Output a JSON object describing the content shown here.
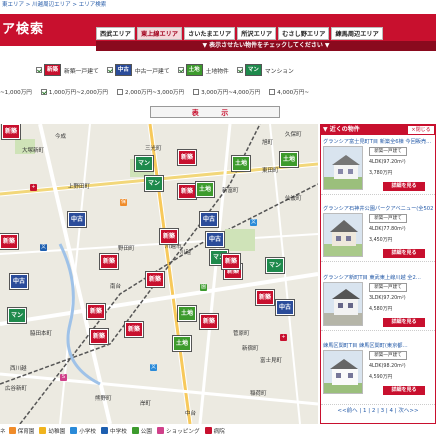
{
  "breadcrumb": [
    "東エリア",
    "川越周辺エリア",
    "エリア検索"
  ],
  "page_title": "ア検索",
  "area_tabs": [
    {
      "label": "西武エリア",
      "active": false
    },
    {
      "label": "東上線エリア",
      "active": true
    },
    {
      "label": "さいたまエリア",
      "active": false
    },
    {
      "label": "所沢エリア",
      "active": false
    },
    {
      "label": "むさし野エリア",
      "active": false
    },
    {
      "label": "練馬周辺エリア",
      "active": false
    }
  ],
  "banner_text": "▼ 表示させたい物件をチェックしてください ▼",
  "property_types": [
    {
      "badge": "新築",
      "label": "新築一戸建て",
      "checked": true,
      "color": "#c8102e"
    },
    {
      "badge": "中古",
      "label": "中古一戸建て",
      "checked": true,
      "color": "#2b4c9a"
    },
    {
      "badge": "土地",
      "label": "土地物件",
      "checked": true,
      "color": "#3d9b2d"
    },
    {
      "badge": "マン",
      "label": "マンション",
      "checked": true,
      "color": "#1e8a4c"
    }
  ],
  "price_ranges": [
    {
      "label": "~1,000万円",
      "checked": false
    },
    {
      "label": "1,000万円~2,000万円",
      "checked": true
    },
    {
      "label": "2,000万円~3,000万円",
      "checked": false
    },
    {
      "label": "3,000万円~4,000万円",
      "checked": false
    },
    {
      "label": "4,000万円~",
      "checked": false
    }
  ],
  "show_button": "表 示",
  "map": {
    "markers": [
      {
        "kind": "new",
        "text": "新築"
      },
      {
        "kind": "new",
        "text": "新築"
      },
      {
        "kind": "man",
        "text": "マン"
      },
      {
        "kind": "land",
        "text": "土地"
      },
      {
        "kind": "land",
        "text": "土地"
      },
      {
        "kind": "man",
        "text": "マン"
      },
      {
        "kind": "used",
        "text": "中古"
      },
      {
        "kind": "new",
        "text": "新築"
      },
      {
        "kind": "land",
        "text": "土地"
      },
      {
        "kind": "new",
        "text": "新築"
      },
      {
        "kind": "used",
        "text": "中古"
      },
      {
        "kind": "man",
        "text": "マン"
      },
      {
        "kind": "new",
        "text": "新築"
      },
      {
        "kind": "new",
        "text": "新築"
      },
      {
        "kind": "new",
        "text": "新築"
      },
      {
        "kind": "used",
        "text": "中古"
      },
      {
        "kind": "man",
        "text": "マン"
      },
      {
        "kind": "new",
        "text": "新築"
      },
      {
        "kind": "land",
        "text": "土地"
      },
      {
        "kind": "new",
        "text": "新築"
      },
      {
        "kind": "new",
        "text": "新築"
      },
      {
        "kind": "used",
        "text": "中古"
      },
      {
        "kind": "new",
        "text": "新築"
      },
      {
        "kind": "man",
        "text": "マン"
      },
      {
        "kind": "land",
        "text": "土地"
      },
      {
        "kind": "new",
        "text": "新築"
      },
      {
        "kind": "new",
        "text": "新築"
      },
      {
        "kind": "used",
        "text": "中古"
      },
      {
        "kind": "new",
        "text": "新築"
      }
    ],
    "labels": [
      "今成",
      "三光町",
      "大塚新町",
      "上野田町",
      "野田町",
      "川越市",
      "川越",
      "新富町",
      "東田町",
      "仙波町",
      "脇田本町",
      "新宿町",
      "富士見町",
      "菅原町",
      "西川越",
      "久保町",
      "旭町",
      "岸町",
      "稲荷町",
      "南台",
      "熊野町",
      "広谷新町",
      "中台"
    ]
  },
  "side_panel": {
    "heading": "▼ 近くの物件",
    "close_label": "×閉じる",
    "cards": [
      {
        "title": "グランシア富士見町T目 新築全6棟 今回販売…",
        "tag": "新築一戸建て",
        "spec1": "4LDK(97.20m²)",
        "spec2": "3,780万円",
        "button": "詳細を見る"
      },
      {
        "title": "グランシア石神井公園パークアベニュー(全502…",
        "tag": "新築一戸建て",
        "spec1": "4LDK(77.80m²)",
        "spec2": "3,450万円",
        "button": "詳細を見る"
      },
      {
        "title": "グランシア新町T目 東武東上線川越 全2…",
        "tag": "新築一戸建て",
        "spec1": "3LDK(97.20m²)",
        "spec2": "4,580万円",
        "button": "詳細を見る"
      },
      {
        "title": "練馬区関町T目 練馬区関町(東京都…",
        "tag": "新築一戸建て",
        "spec1": "4LDK(98.20m²)",
        "spec2": "4,590万円",
        "button": "詳細を見る"
      }
    ],
    "pager": "<<前へ | 1 | 2 | 3 | 4 | 次へ>>"
  },
  "legend": {
    "prefix": "ネ",
    "items": [
      {
        "label": "保育園",
        "color": "#f08c2a"
      },
      {
        "label": "幼稚園",
        "color": "#f0b41e"
      },
      {
        "label": "小学校",
        "color": "#2a8ad8"
      },
      {
        "label": "中学校",
        "color": "#1d5fb0"
      },
      {
        "label": "公園",
        "color": "#3d9b2d"
      },
      {
        "label": "ショッピング",
        "color": "#d0408a"
      },
      {
        "label": "病院",
        "color": "#c8102e"
      }
    ]
  }
}
